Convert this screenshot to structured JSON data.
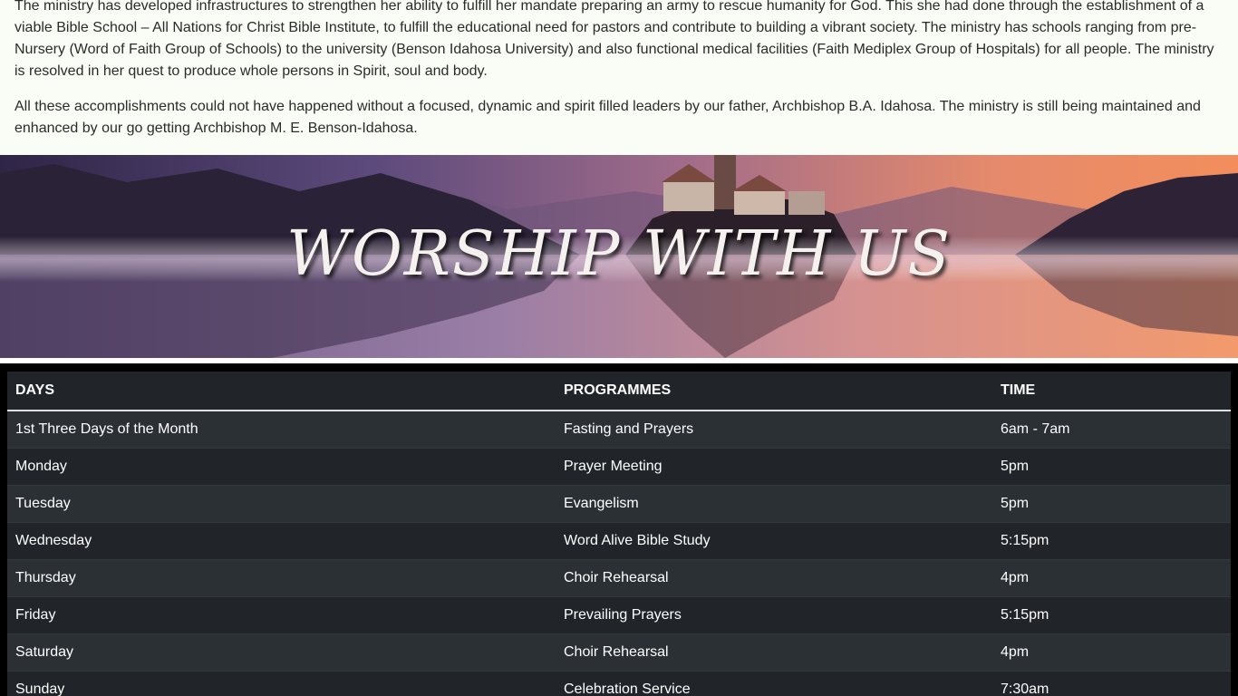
{
  "about": {
    "paragraph1": "The ministry has developed infrastructures to strengthen her ability to fulfill her mandate preparing an army to rescue humanity for God. This she had done through the establishment of a viable Bible School – All Nations for Christ Bible Institute, to fulfill the educational need for pastors and contribute to building a vibrant society. The ministry has schools ranging from pre-Nursery (Word of Faith Group of Schools) to the university (Benson Idahosa University) and also functional medical facilities (Faith Mediplex Group of Hospitals) for all people. The ministry is resolved in her quest to produce whole persons in Spirit, soul and body.",
    "paragraph2": "All these accomplishments could not have happened without a focused, dynamic and spirit filled leaders by our father, Archbishop B.A. Idahosa. The ministry is still being maintained and enhanced by our go getting Archbishop M. E. Benson-Idahosa."
  },
  "banner": {
    "title": "WORSHIP WITH US"
  },
  "schedule": {
    "headers": [
      "DAYS",
      "PROGRAMMES",
      "TIME"
    ],
    "rows": [
      {
        "day": "1st Three Days of the Month",
        "programme": "Fasting and Prayers",
        "time": "6am - 7am"
      },
      {
        "day": "Monday",
        "programme": "Prayer Meeting",
        "time": "5pm"
      },
      {
        "day": "Tuesday",
        "programme": "Evangelism",
        "time": "5pm"
      },
      {
        "day": "Wednesday",
        "programme": "Word Alive Bible Study",
        "time": "5:15pm"
      },
      {
        "day": "Thursday",
        "programme": "Choir Rehearsal",
        "time": "4pm"
      },
      {
        "day": "Friday",
        "programme": "Prevailing Prayers",
        "time": "5:15pm"
      },
      {
        "day": "Saturday",
        "programme": "Choir Rehearsal",
        "time": "4pm"
      },
      {
        "day": "Sunday",
        "programme": "Celebration Service",
        "time": "7:30am"
      }
    ]
  }
}
